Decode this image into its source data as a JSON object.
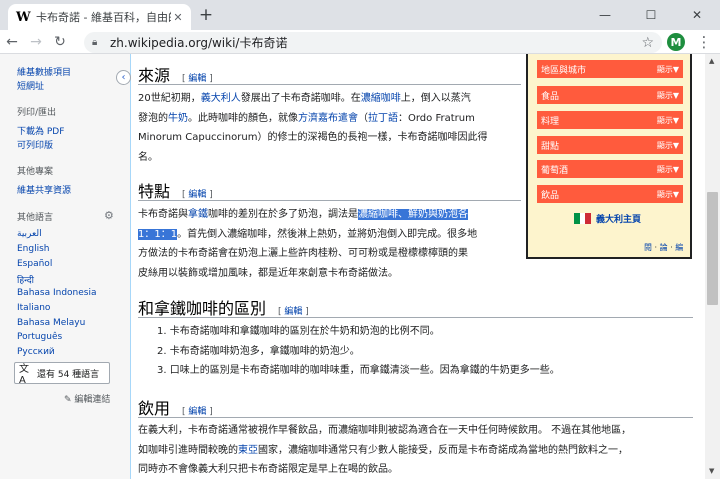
{
  "browser": {
    "tab_title": "卡布奇諾 - 維基百科，自由的百科全書",
    "tab_favicon": "W",
    "url": "zh.wikipedia.org/wiki/卡布奇诺",
    "profile_initial": "M"
  },
  "sidebar": {
    "top_items": [
      "維基數據項目",
      "短網址"
    ],
    "print_heading": "列印/匯出",
    "print_items": [
      "下載為 PDF",
      "可列印版"
    ],
    "projects_heading": "其他專案",
    "projects_items": [
      "維基共享資源"
    ],
    "languages_heading": "其他語言",
    "languages": [
      "العربية",
      "English",
      "Español",
      "हिन्दी",
      "Bahasa Indonesia",
      "Italiano",
      "Bahasa Melayu",
      "Português",
      "Русский"
    ],
    "more_languages": "還有 54 種語言",
    "edit_links": "✎ 編輯連結"
  },
  "content": {
    "sections": {
      "origin": {
        "title": "來源",
        "edit": "編輯"
      },
      "features": {
        "title": "特點",
        "edit": "編輯"
      },
      "latte": {
        "title": "和拿鐵咖啡的區別",
        "edit": "編輯"
      },
      "drink": {
        "title": "飲用",
        "edit": "編輯"
      }
    },
    "edit_open": "[",
    "edit_close": "]",
    "origin_p": {
      "l1a": "20世紀初期，",
      "l1b": "義大利人",
      "l1c": "發展出了卡布奇諾咖啡。在",
      "l1d": "濃縮咖啡",
      "l1e": "上，倒入以蒸汽",
      "l2a": "發泡的",
      "l2b": "牛奶",
      "l2c": "。此時咖啡的顏色，就像",
      "l2d": "方濟嘉布遣會",
      "l2e": "（",
      "l2f": "拉丁語",
      "l2g": "：Ordo Fratrum",
      "l3": "Minorum Capuccinorum）的修士的深褐色的長袍一樣，卡布奇諾咖啡因此得",
      "l4": "名。"
    },
    "features_p": {
      "l1a": "卡布奇諾與",
      "l1b": "拿鐵",
      "l1c": "咖啡的差別在於多了奶泡，調法是",
      "l1d": "濃縮咖啡、鮮奶與奶泡各",
      "l2a": "1：1：1",
      "l2b": "。首先倒入濃縮咖啡，然後淋上熱奶，並將奶泡倒入即完成。很多地",
      "l3": "方做法的卡布奇諾會在奶泡上灑上些許肉桂粉、可可粉或是橙檬檬檸頭的果",
      "l4": "皮絲用以裝飾或增加風味，都是近年來創意卡布奇諾做法。"
    },
    "latte_list": [
      "1. 卡布奇諾咖啡和拿鐵咖啡的區別在於牛奶和奶泡的比例不同。",
      "2. 卡布奇諾咖啡奶泡多，拿鐵咖啡的奶泡少。",
      "3. 口味上的區別是卡布奇諾咖啡的咖啡味重，而拿鐵清淡一些。因為拿鐵的牛奶更多一些。"
    ],
    "drink_p": {
      "l1": "在義大利，卡布奇諾通常被視作早餐飲品，而濃縮咖啡則被認為適合在一天中任何時候飲用。 不過在其他地區，",
      "l2a": "如咖啡引進時間較晚的",
      "l2b": "東亞",
      "l2c": "國家，濃縮咖啡通常只有少數人能接受，反而是卡布奇諾成為當地的熱門飲料之一，",
      "l3": "同時亦不會像義大利只把卡布奇諾限定是早上在喝的飲品。"
    }
  },
  "infobox": {
    "rows": [
      {
        "name": "地區與城市",
        "toggle": "顯示▼"
      },
      {
        "name": "食品",
        "toggle": "顯示▼"
      },
      {
        "name": "料理",
        "toggle": "顯示▼"
      },
      {
        "name": "甜點",
        "toggle": "顯示▼"
      },
      {
        "name": "葡萄酒",
        "toggle": "顯示▼"
      },
      {
        "name": "飲品",
        "toggle": "顯示▼"
      }
    ],
    "portal": "義大利主頁",
    "nav_view": "閱",
    "nav_talk": "論",
    "nav_edit": "編",
    "nav_sep": "·"
  },
  "colors": {
    "link": "#0645ad",
    "infobox_row": "#ff5b3d",
    "infobox_bg": "#fdf4cd",
    "selection": "#3875d7",
    "flag_green": "#009246",
    "flag_white": "#ffffff",
    "flag_red": "#ce2b37"
  }
}
